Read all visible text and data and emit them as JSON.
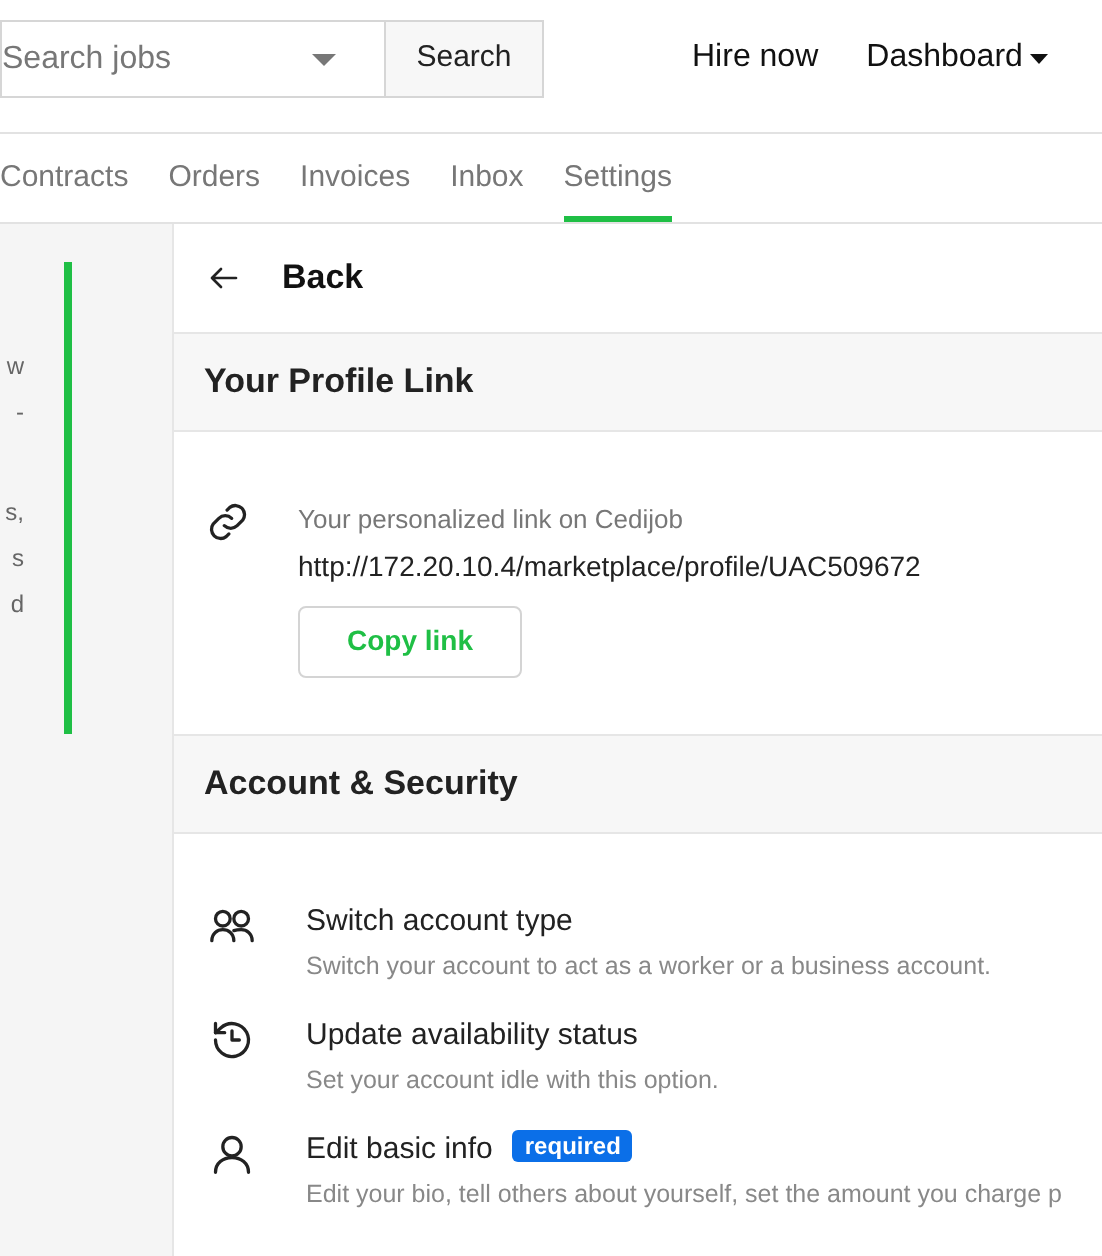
{
  "header": {
    "search": {
      "placeholder": "Search jobs",
      "button": "Search"
    },
    "nav": [
      {
        "label": "Hire now",
        "dropdown": false
      },
      {
        "label": "Dashboard",
        "dropdown": true
      }
    ]
  },
  "tabs": [
    {
      "label": "Contracts",
      "selected": false
    },
    {
      "label": "Orders",
      "selected": false
    },
    {
      "label": "Invoices",
      "selected": false
    },
    {
      "label": "Inbox",
      "selected": false
    },
    {
      "label": "Settings",
      "selected": true
    }
  ],
  "sidebar": {
    "lines": [
      "w",
      "-",
      "s,",
      "s",
      "d"
    ]
  },
  "back": "Back",
  "sections": [
    {
      "title": "Your Profile Link",
      "kind": "link",
      "caption": "Your personalized link on Cedijob",
      "url": "http://172.20.10.4/marketplace/profile/UAC509672",
      "button": "Copy link"
    },
    {
      "title": "Account & Security",
      "kind": "list",
      "items": [
        {
          "title": "Switch account type",
          "description": "Switch your account to act as a worker or a business account."
        },
        {
          "title": "Update availability status",
          "description": "Set your account idle with this option."
        },
        {
          "title": "Edit basic info",
          "badge": "required",
          "description": "Edit your bio, tell others about yourself, set the amount you charge p"
        }
      ]
    }
  ]
}
